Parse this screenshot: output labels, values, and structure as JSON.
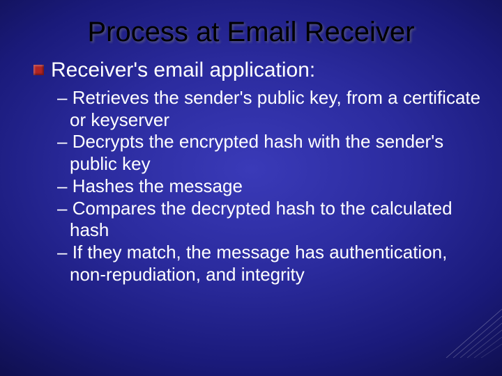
{
  "title": "Process at Email Receiver",
  "level1": "Receiver's email application:",
  "items": [
    "Retrieves the sender's public key, from a certificate or keyserver",
    "Decrypts the encrypted hash with the sender's public key",
    "Hashes the message",
    "Compares the decrypted hash to the calculated hash",
    "If they match, the message has authentication, non-repudiation, and integrity"
  ],
  "dash": "– "
}
